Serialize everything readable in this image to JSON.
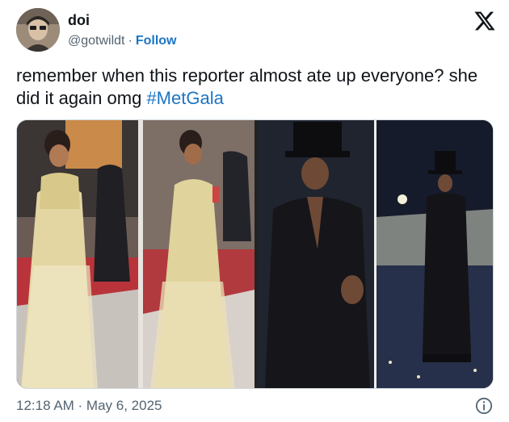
{
  "author": {
    "display_name": "doi",
    "handle": "@gotwildt",
    "separator": "·",
    "follow_label": "Follow"
  },
  "tweet": {
    "text": "remember when this reporter almost ate up everyone? she did it again omg ",
    "hashtag": "#MetGala"
  },
  "media": {
    "photo_1_desc_icon": "photo-gold-gown",
    "photo_2_desc_icon": "photo-black-suit-top-hat"
  },
  "footer": {
    "timestamp": "12:18 AM · May 6, 2025"
  },
  "icons": {
    "logo": "x-logo-icon",
    "info": "info-icon"
  },
  "colors": {
    "link": "#1d75c4",
    "secondary_text": "#536471",
    "border": "#cfd9de"
  }
}
